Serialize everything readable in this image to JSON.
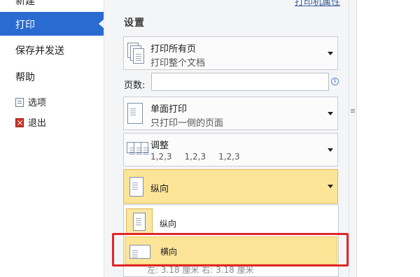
{
  "nav": {
    "new": "新建",
    "print": "打印",
    "save_send": "保存并发送",
    "help": "帮助",
    "options": "选项",
    "exit": "退出"
  },
  "printer_properties": "打印机属性",
  "settings": {
    "title": "设置",
    "print_range": {
      "main": "打印所有页",
      "sub": "打印整个文档"
    },
    "pages_label": "页数:",
    "pages_value": "",
    "sides": {
      "main": "单面打印",
      "sub": "只打印一侧的页面"
    },
    "collate": {
      "main": "调整",
      "groups": [
        "1,2,3",
        "1,2,3",
        "1,2,3"
      ]
    },
    "orientation": {
      "main": "纵向"
    },
    "orientation_menu": {
      "options": [
        "纵向",
        "横向"
      ],
      "highlighted": "横向",
      "partial_footer": "左: 3.18 厘米   右: 3.18 厘米"
    }
  },
  "colors": {
    "accent": "#2a6bd2",
    "selected_fill": "#fde597",
    "selected_border": "#e5b74a",
    "annotation_red": "#e0262b"
  }
}
